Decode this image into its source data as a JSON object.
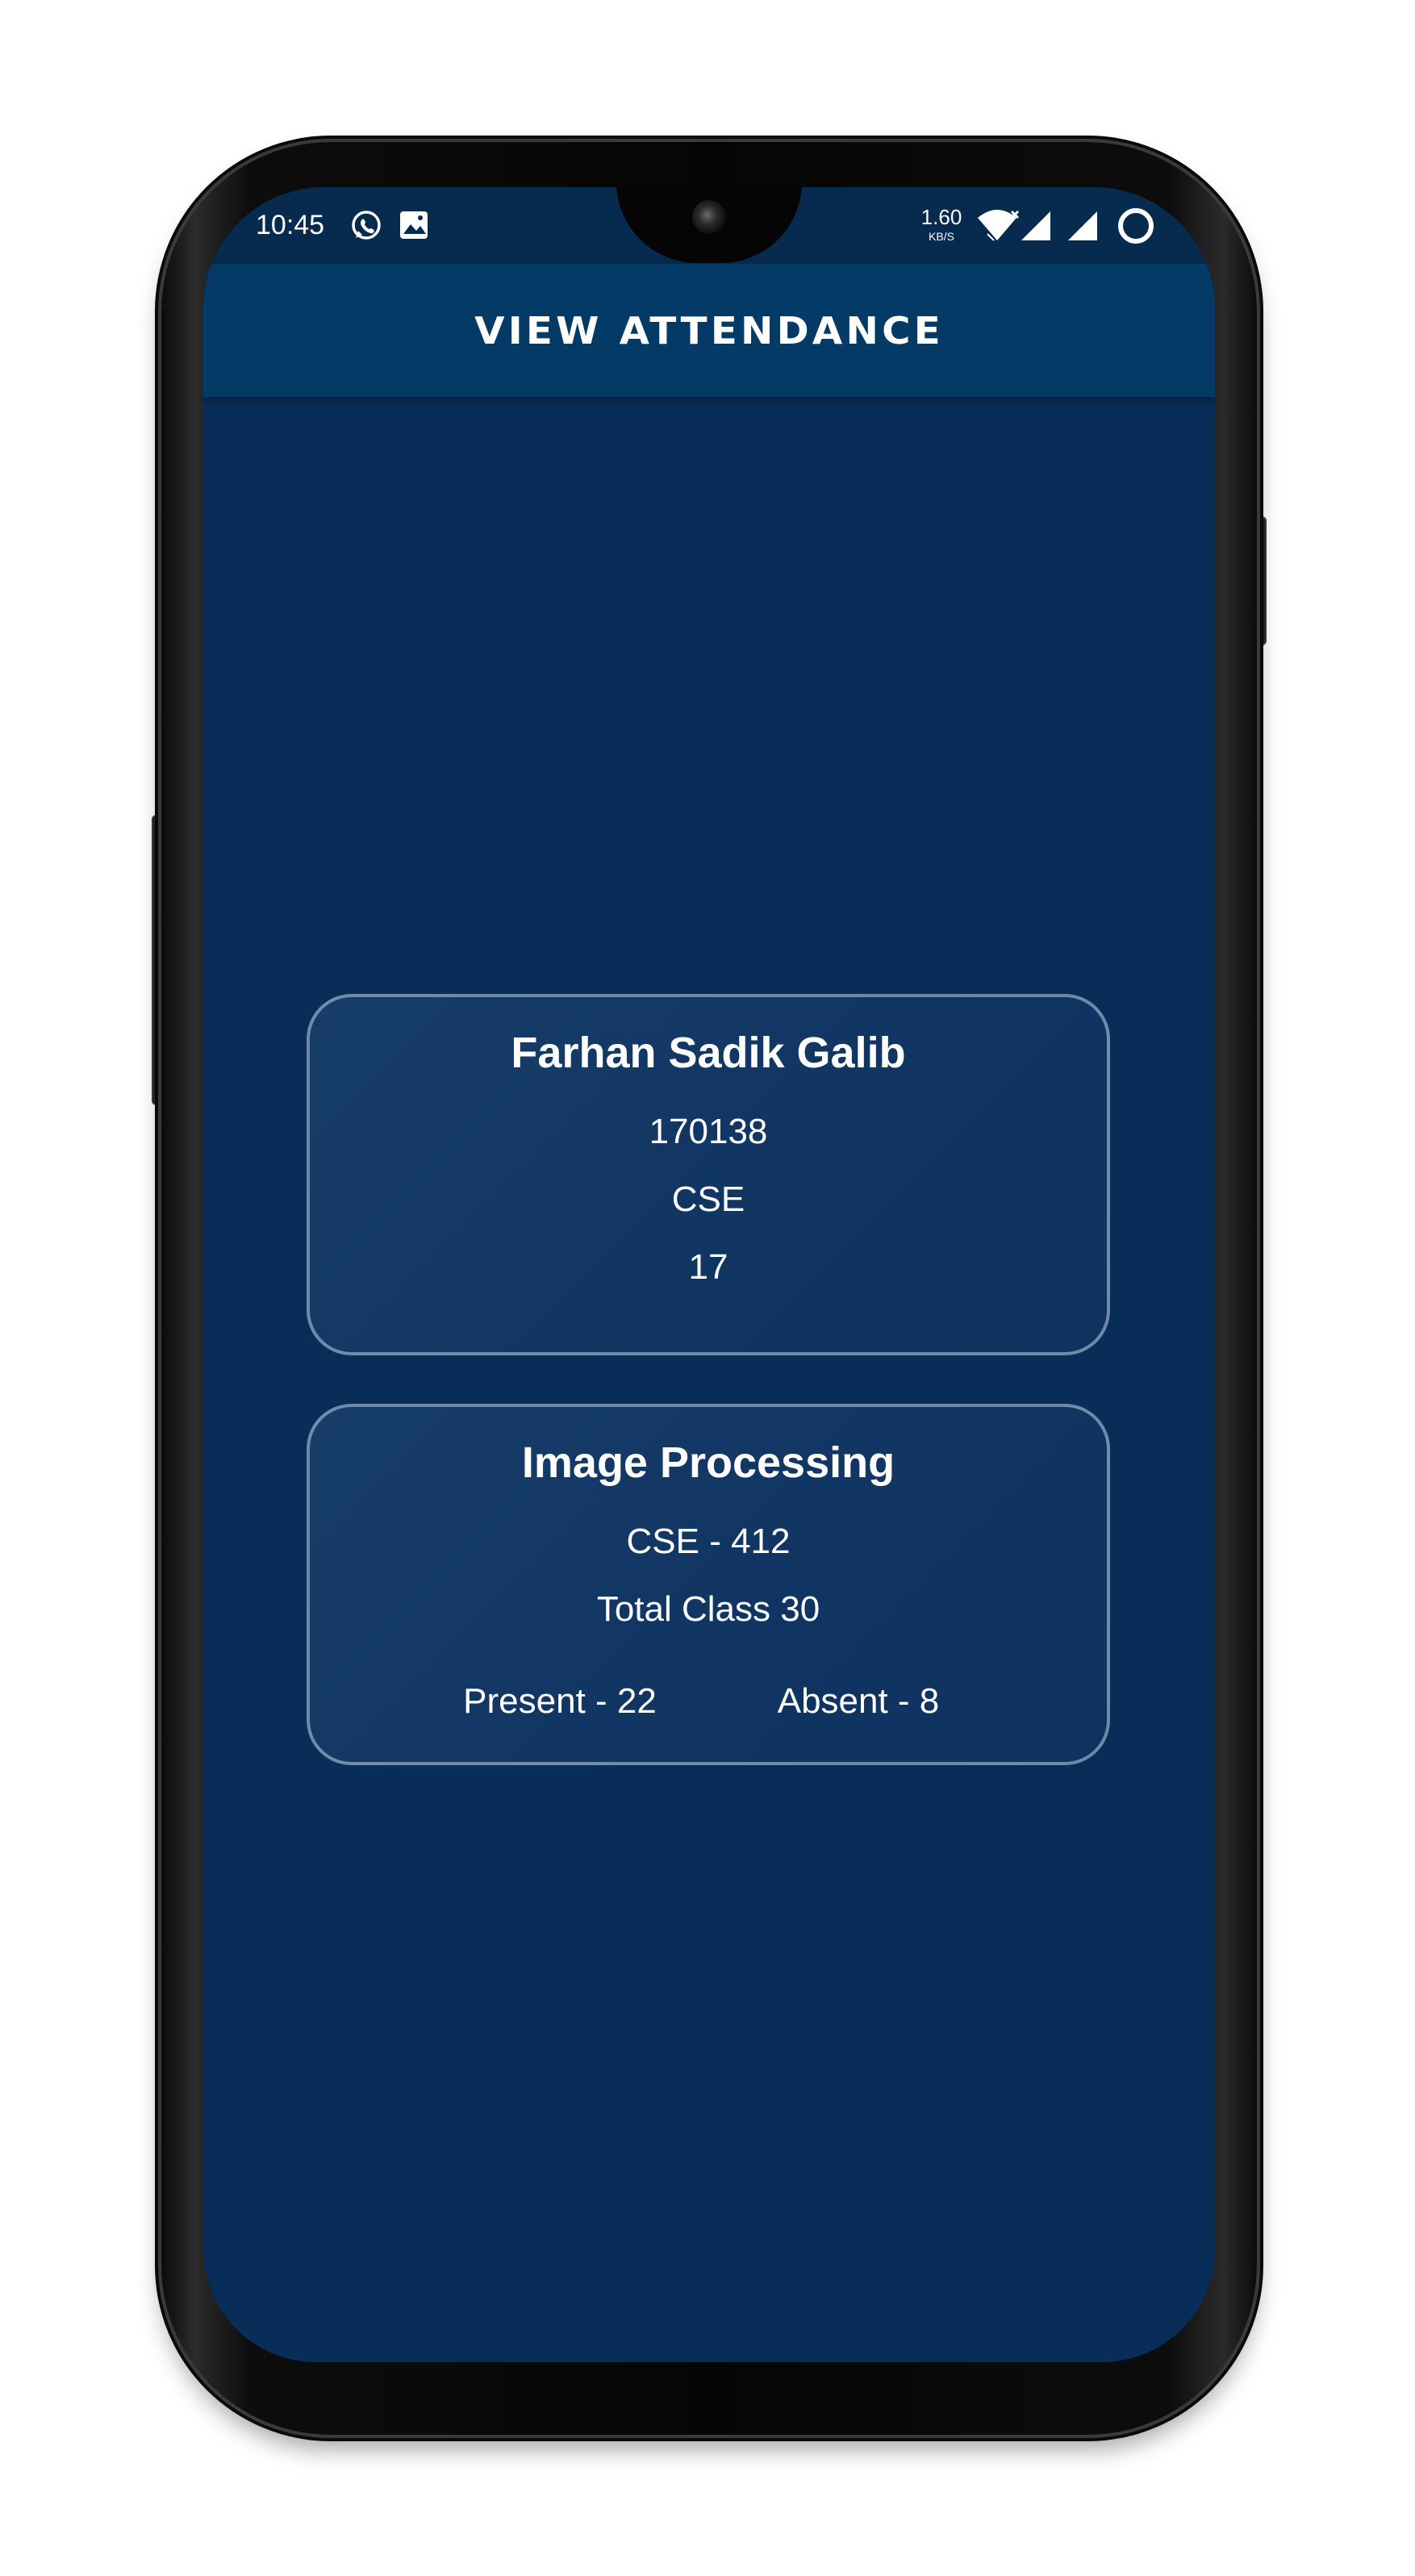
{
  "status_bar": {
    "time": "10:45",
    "speed_value": "1.60",
    "speed_unit": "KB/S",
    "icons": [
      "whatsapp-icon",
      "image-icon",
      "wifi-icon",
      "signal-icon",
      "signal-icon",
      "loading-icon"
    ]
  },
  "app_bar": {
    "title": "VIEW ATTENDANCE"
  },
  "student_card": {
    "name": "Farhan Sadik Galib",
    "id": "170138",
    "department": "CSE",
    "batch": "17"
  },
  "course_card": {
    "title": "Image Processing",
    "code": "CSE - 412",
    "total_classes": "Total Class 30",
    "present": "Present - 22",
    "absent": "Absent - 8"
  },
  "colors": {
    "screen_background": "#082d58",
    "app_bar": "#043a66",
    "card_background": "#153a66",
    "card_border": "#bccde1",
    "text": "#ffffff"
  }
}
